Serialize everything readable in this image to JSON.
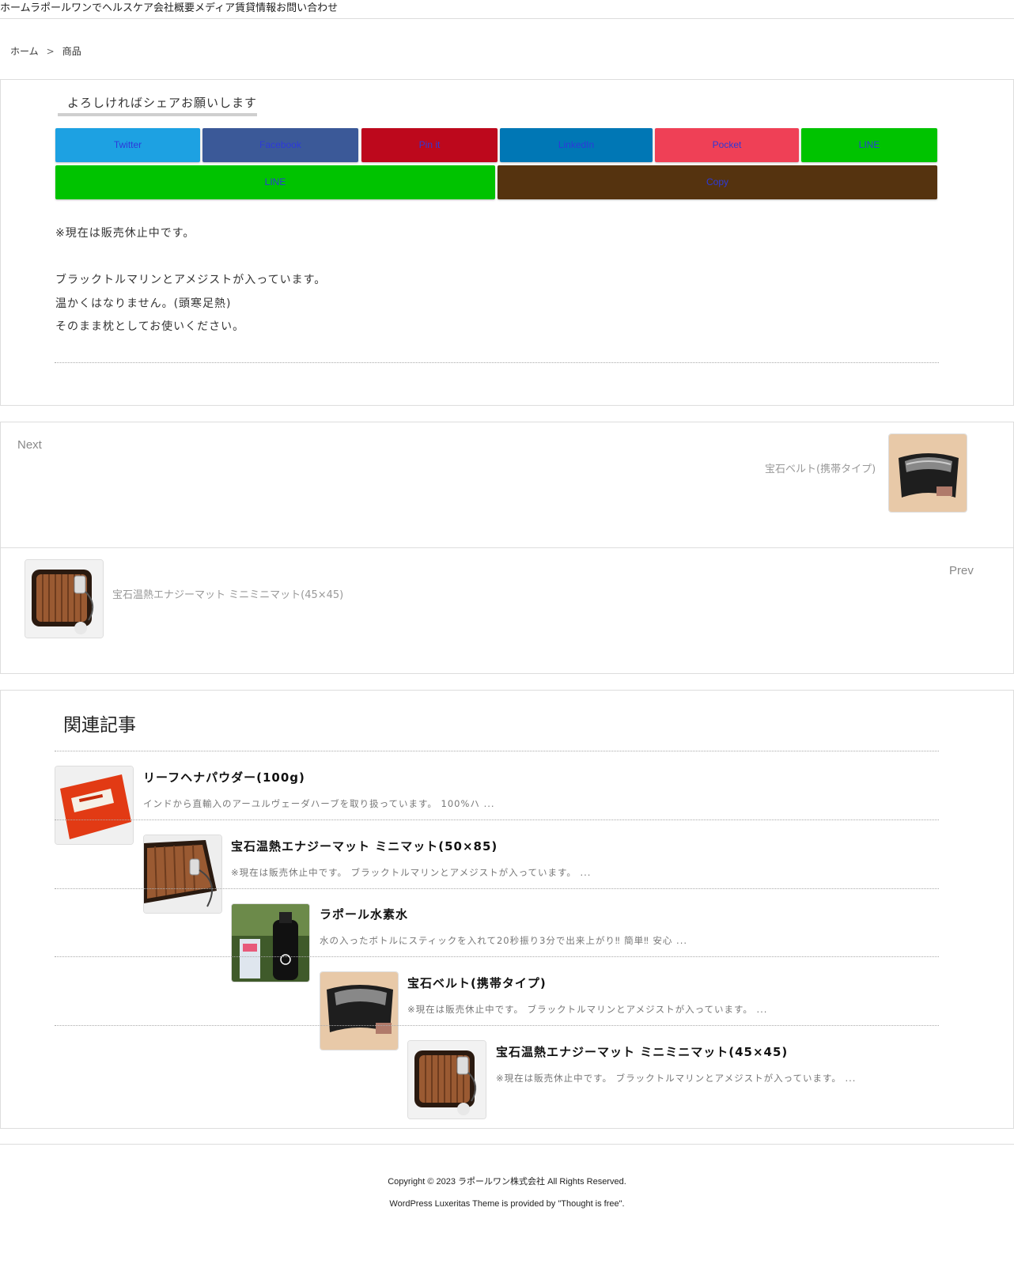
{
  "topnav": {
    "items": [
      "ホーム",
      "ラポールワンでヘルスケア",
      "会社概要",
      "メディア",
      "賃貸情報",
      "お問い合わせ"
    ]
  },
  "breadcrumb": {
    "home": "ホーム",
    "separator": ">",
    "current": "商品"
  },
  "share": {
    "heading": "よろしければシェアお願いします",
    "buttons": [
      {
        "label": "Twitter",
        "color": "#1da1e2"
      },
      {
        "label": "Facebook",
        "color": "#3b5998"
      },
      {
        "label": "Pin it",
        "color": "#bd081c"
      },
      {
        "label": "LinkedIn",
        "color": "#0077b5"
      },
      {
        "label": "Pocket",
        "color": "#ef4056"
      },
      {
        "label": "LINE",
        "color": "#00c300"
      },
      {
        "label": "LINE",
        "color": "#00c300"
      },
      {
        "label": "Copy",
        "color": "#55330f"
      }
    ]
  },
  "article": {
    "lines": [
      "※現在は販売休止中です。",
      "ブラックトルマリンとアメジストが入っています。",
      "温かくはなりません。(頭寒足熱)",
      "そのまま枕としてお使いください。"
    ]
  },
  "post_nav": {
    "next_label": "Next",
    "next_title": "宝石ベルト(携帯タイプ)",
    "prev_label": "Prev",
    "prev_title": "宝石温熱エナジーマット ミニミニマット(45×45)"
  },
  "related": {
    "heading": "関連記事",
    "items": [
      {
        "title": "リーフヘナパウダー(100g)",
        "excerpt": "インドから直輸入のアーユルヴェーダハーブを取り扱っています。 100%ハ ..."
      },
      {
        "title": "宝石温熱エナジーマット ミニマット(50×85)",
        "excerpt": "※現在は販売休止中です。 ブラックトルマリンとアメジストが入っています。 ..."
      },
      {
        "title": "ラポール水素水",
        "excerpt": "水の入ったボトルにスティックを入れて20秒振り3分で出来上がり‼ 簡単‼ 安心 ..."
      },
      {
        "title": "宝石ベルト(携帯タイプ)",
        "excerpt": "※現在は販売休止中です。 ブラックトルマリンとアメジストが入っています。 ..."
      },
      {
        "title": "宝石温熱エナジーマット ミニミニマット(45×45)",
        "excerpt": "※現在は販売休止中です。 ブラックトルマリンとアメジストが入っています。 ..."
      }
    ]
  },
  "footer": {
    "copyright": "Copyright © 2023 ラポールワン株式会社 All Rights Reserved.",
    "credit": "WordPress Luxeritas Theme is provided by \"Thought is free\"."
  }
}
